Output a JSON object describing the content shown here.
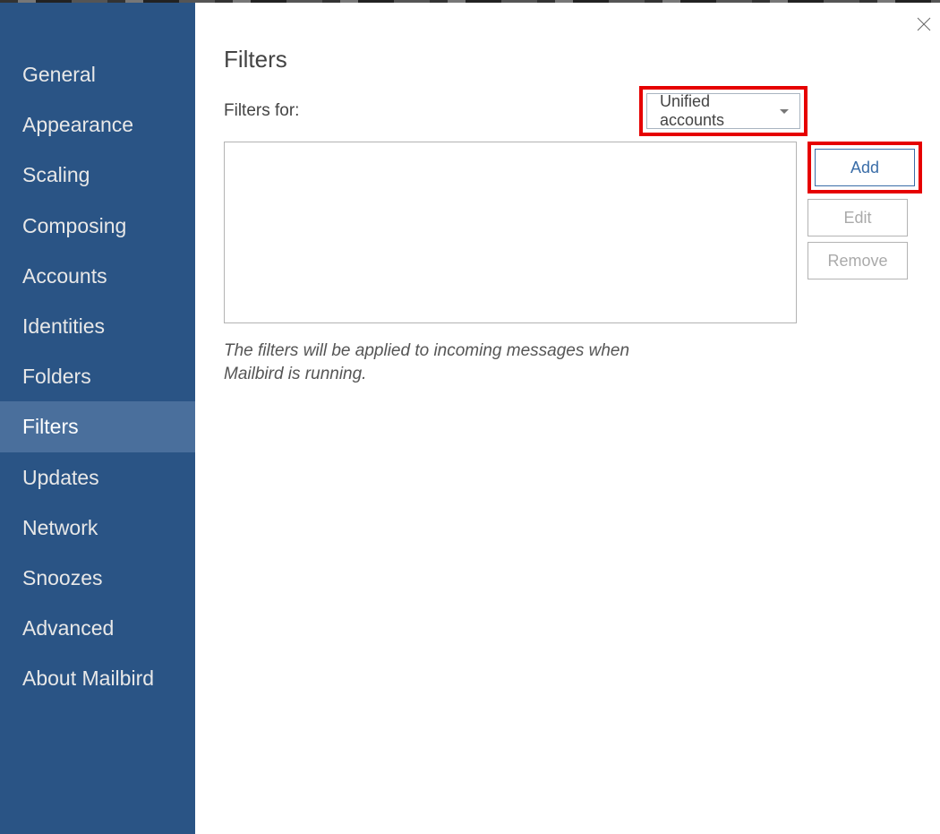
{
  "sidebar": {
    "items": [
      {
        "label": "General",
        "active": false
      },
      {
        "label": "Appearance",
        "active": false
      },
      {
        "label": "Scaling",
        "active": false
      },
      {
        "label": "Composing",
        "active": false
      },
      {
        "label": "Accounts",
        "active": false
      },
      {
        "label": "Identities",
        "active": false
      },
      {
        "label": "Folders",
        "active": false
      },
      {
        "label": "Filters",
        "active": true
      },
      {
        "label": "Updates",
        "active": false
      },
      {
        "label": "Network",
        "active": false
      },
      {
        "label": "Snoozes",
        "active": false
      },
      {
        "label": "Advanced",
        "active": false
      },
      {
        "label": "About Mailbird",
        "active": false
      }
    ]
  },
  "main": {
    "title": "Filters",
    "filter_label": "Filters for:",
    "account_select": "Unified accounts",
    "add_label": "Add",
    "edit_label": "Edit",
    "remove_label": "Remove",
    "note_text": "The filters will be applied to incoming messages when Mailbird is running."
  },
  "highlights": {
    "dropdown": true,
    "add_button": true
  },
  "colors": {
    "sidebar_bg": "#2a5485",
    "sidebar_active_bg": "#4a6f9c",
    "accent": "#3a6da8",
    "highlight": "#e60000"
  }
}
